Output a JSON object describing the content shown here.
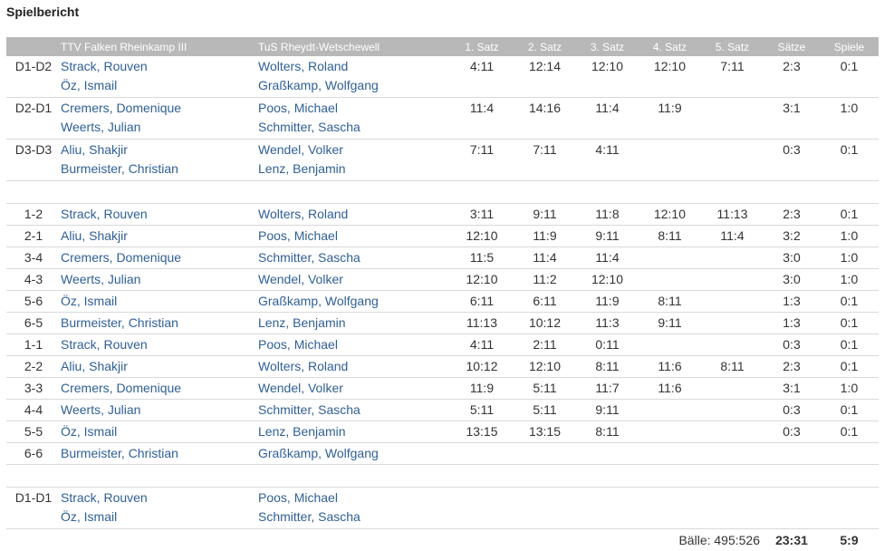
{
  "title": "Spielbericht",
  "headers": {
    "home": "TTV Falken Rheinkamp III",
    "away": "TuS Rheydt-Wetschewell",
    "sets": [
      "1. Satz",
      "2. Satz",
      "3. Satz",
      "4. Satz",
      "5. Satz"
    ],
    "saetze": "Sätze",
    "spiele": "Spiele"
  },
  "doubles": [
    {
      "pos": "D1-D2",
      "home": [
        "Strack, Rouven",
        "Öz, Ismail"
      ],
      "away": [
        "Wolters, Roland",
        "Graßkamp, Wolfgang"
      ],
      "sets": [
        "4:11",
        "12:14",
        "12:10",
        "12:10",
        "7:11"
      ],
      "saetze": "2:3",
      "spiele": "0:1"
    },
    {
      "pos": "D2-D1",
      "home": [
        "Cremers, Domenique",
        "Weerts, Julian"
      ],
      "away": [
        "Poos, Michael",
        "Schmitter, Sascha"
      ],
      "sets": [
        "11:4",
        "14:16",
        "11:4",
        "11:9",
        ""
      ],
      "saetze": "3:1",
      "spiele": "1:0"
    },
    {
      "pos": "D3-D3",
      "home": [
        "Aliu, Shakjir",
        "Burmeister, Christian"
      ],
      "away": [
        "Wendel, Volker",
        "Lenz, Benjamin"
      ],
      "sets": [
        "7:11",
        "7:11",
        "4:11",
        "",
        ""
      ],
      "saetze": "0:3",
      "spiele": "0:1"
    }
  ],
  "singles": [
    {
      "pos": "1-2",
      "home": "Strack, Rouven",
      "away": "Wolters, Roland",
      "sets": [
        "3:11",
        "9:11",
        "11:8",
        "12:10",
        "11:13"
      ],
      "saetze": "2:3",
      "spiele": "0:1"
    },
    {
      "pos": "2-1",
      "home": "Aliu, Shakjir",
      "away": "Poos, Michael",
      "sets": [
        "12:10",
        "11:9",
        "9:11",
        "8:11",
        "11:4"
      ],
      "saetze": "3:2",
      "spiele": "1:0"
    },
    {
      "pos": "3-4",
      "home": "Cremers, Domenique",
      "away": "Schmitter, Sascha",
      "sets": [
        "11:5",
        "11:4",
        "11:4",
        "",
        ""
      ],
      "saetze": "3:0",
      "spiele": "1:0"
    },
    {
      "pos": "4-3",
      "home": "Weerts, Julian",
      "away": "Wendel, Volker",
      "sets": [
        "12:10",
        "11:2",
        "12:10",
        "",
        ""
      ],
      "saetze": "3:0",
      "spiele": "1:0"
    },
    {
      "pos": "5-6",
      "home": "Öz, Ismail",
      "away": "Graßkamp, Wolfgang",
      "sets": [
        "6:11",
        "6:11",
        "11:9",
        "8:11",
        ""
      ],
      "saetze": "1:3",
      "spiele": "0:1"
    },
    {
      "pos": "6-5",
      "home": "Burmeister, Christian",
      "away": "Lenz, Benjamin",
      "sets": [
        "11:13",
        "10:12",
        "11:3",
        "9:11",
        ""
      ],
      "saetze": "1:3",
      "spiele": "0:1"
    },
    {
      "pos": "1-1",
      "home": "Strack, Rouven",
      "away": "Poos, Michael",
      "sets": [
        "4:11",
        "2:11",
        "0:11",
        "",
        ""
      ],
      "saetze": "0:3",
      "spiele": "0:1"
    },
    {
      "pos": "2-2",
      "home": "Aliu, Shakjir",
      "away": "Wolters, Roland",
      "sets": [
        "10:12",
        "12:10",
        "8:11",
        "11:6",
        "8:11"
      ],
      "saetze": "2:3",
      "spiele": "0:1"
    },
    {
      "pos": "3-3",
      "home": "Cremers, Domenique",
      "away": "Wendel, Volker",
      "sets": [
        "11:9",
        "5:11",
        "11:7",
        "11:6",
        ""
      ],
      "saetze": "3:1",
      "spiele": "1:0"
    },
    {
      "pos": "4-4",
      "home": "Weerts, Julian",
      "away": "Schmitter, Sascha",
      "sets": [
        "5:11",
        "5:11",
        "9:11",
        "",
        ""
      ],
      "saetze": "0:3",
      "spiele": "0:1"
    },
    {
      "pos": "5-5",
      "home": "Öz, Ismail",
      "away": "Lenz, Benjamin",
      "sets": [
        "13:15",
        "13:15",
        "8:11",
        "",
        ""
      ],
      "saetze": "0:3",
      "spiele": "0:1"
    },
    {
      "pos": "6-6",
      "home": "Burmeister, Christian",
      "away": "Graßkamp, Wolfgang",
      "sets": [
        "",
        "",
        "",
        "",
        ""
      ],
      "saetze": "",
      "spiele": ""
    }
  ],
  "final_double": {
    "pos": "D1-D1",
    "home": [
      "Strack, Rouven",
      "Öz, Ismail"
    ],
    "away": [
      "Poos, Michael",
      "Schmitter, Sascha"
    ]
  },
  "totals": {
    "balls": "Bälle: 495:526",
    "saetze": "23:31",
    "spiele": "5:9"
  },
  "colors": {
    "header_bg": "#b8b8b8",
    "link": "#2f5f96",
    "divider": "#d9d9d9"
  }
}
